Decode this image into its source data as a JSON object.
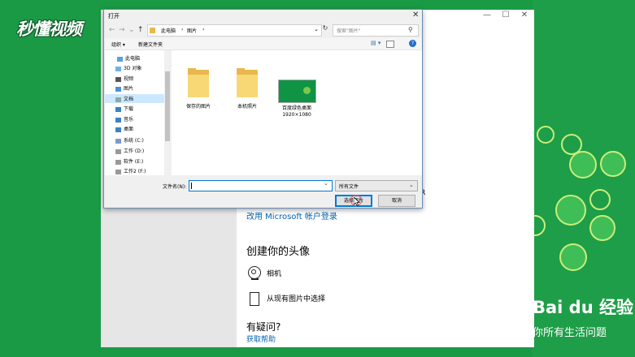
{
  "background": {
    "logo_text": "秒懂视频",
    "watermark_brand": "Bai du 经验",
    "watermark_slogan": "你所有生活问题",
    "colors": {
      "green": "#1a9a45",
      "accent_light": "#c9ee7a"
    }
  },
  "settings": {
    "ms_account_link": "改用 Microsoft 帐户登录",
    "avatar_heading": "创建你的头像",
    "camera_label": "相机",
    "browse_label": "从现有图片中选择",
    "help_heading": "有疑问?",
    "help_link": "获取帮助",
    "cut_text": "R",
    "window_controls": [
      "—",
      "☐",
      "✕"
    ]
  },
  "dialog": {
    "title": "打开",
    "close": "✕",
    "nav": {
      "back": "←",
      "forward": "→",
      "recent": "⌄",
      "up": "↑"
    },
    "address": [
      "此电脑",
      "›",
      "图片",
      "›"
    ],
    "address_dropdown": "⌄",
    "refresh": "↻",
    "search_placeholder": "搜索\"图片\"",
    "search_icon": "⚲",
    "toolbar": {
      "organize": "组织 ▾",
      "new_folder": "新建文件夹",
      "help": "?"
    },
    "nav_items": [
      {
        "label": "此电脑",
        "icon": "pc-icon"
      },
      {
        "label": "3D 对象",
        "icon": "3d-objects-icon"
      },
      {
        "label": "视频",
        "icon": "videos-icon"
      },
      {
        "label": "图片",
        "icon": "pictures-icon",
        "selected": true
      },
      {
        "label": "文档",
        "icon": "documents-icon"
      },
      {
        "label": "下载",
        "icon": "downloads-icon"
      },
      {
        "label": "音乐",
        "icon": "music-icon"
      },
      {
        "label": "桌面",
        "icon": "desktop-icon"
      },
      {
        "label": "系统 (C:)",
        "icon": "drive-icon"
      },
      {
        "label": "工作 (D:)",
        "icon": "drive-icon"
      },
      {
        "label": "软件 (E:)",
        "icon": "drive-icon"
      },
      {
        "label": "工作2 (F:)",
        "icon": "drive-icon"
      }
    ],
    "files": [
      {
        "name": "保存的图片",
        "type": "folder"
      },
      {
        "name": "本机照片",
        "type": "folder"
      },
      {
        "name": "百度绿色桌面",
        "size": "1920×1080",
        "type": "image"
      }
    ],
    "filename_label": "文件名(N):",
    "filename_value": "",
    "filetype_value": "所有文件",
    "buttons": {
      "choose": "选择图片",
      "cancel": "取消"
    }
  }
}
